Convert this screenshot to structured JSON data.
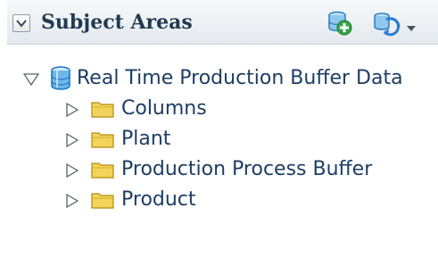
{
  "panel": {
    "title": "Subject Areas",
    "icons": {
      "collapse": "chevron-down-icon",
      "add": "add-subject-area-icon",
      "refresh": "refresh-icon",
      "menu": "dropdown-arrow-icon"
    }
  },
  "tree": {
    "root": {
      "label": "Real Time Production Buffer Data",
      "expanded": true,
      "icon": "database-icon"
    },
    "folders": [
      {
        "label": "Columns",
        "expanded": false,
        "icon": "folder-icon"
      },
      {
        "label": "Plant",
        "expanded": false,
        "icon": "folder-icon"
      },
      {
        "label": "Production Process Buffer",
        "expanded": false,
        "icon": "folder-icon"
      },
      {
        "label": "Product",
        "expanded": false,
        "icon": "folder-icon"
      }
    ]
  },
  "colors": {
    "header_bg": "#e9eef2",
    "label_text": "#1d3e63",
    "folder": "#e8c545",
    "database": "#2e8ad4",
    "add_plus": "#2a9d3a"
  }
}
